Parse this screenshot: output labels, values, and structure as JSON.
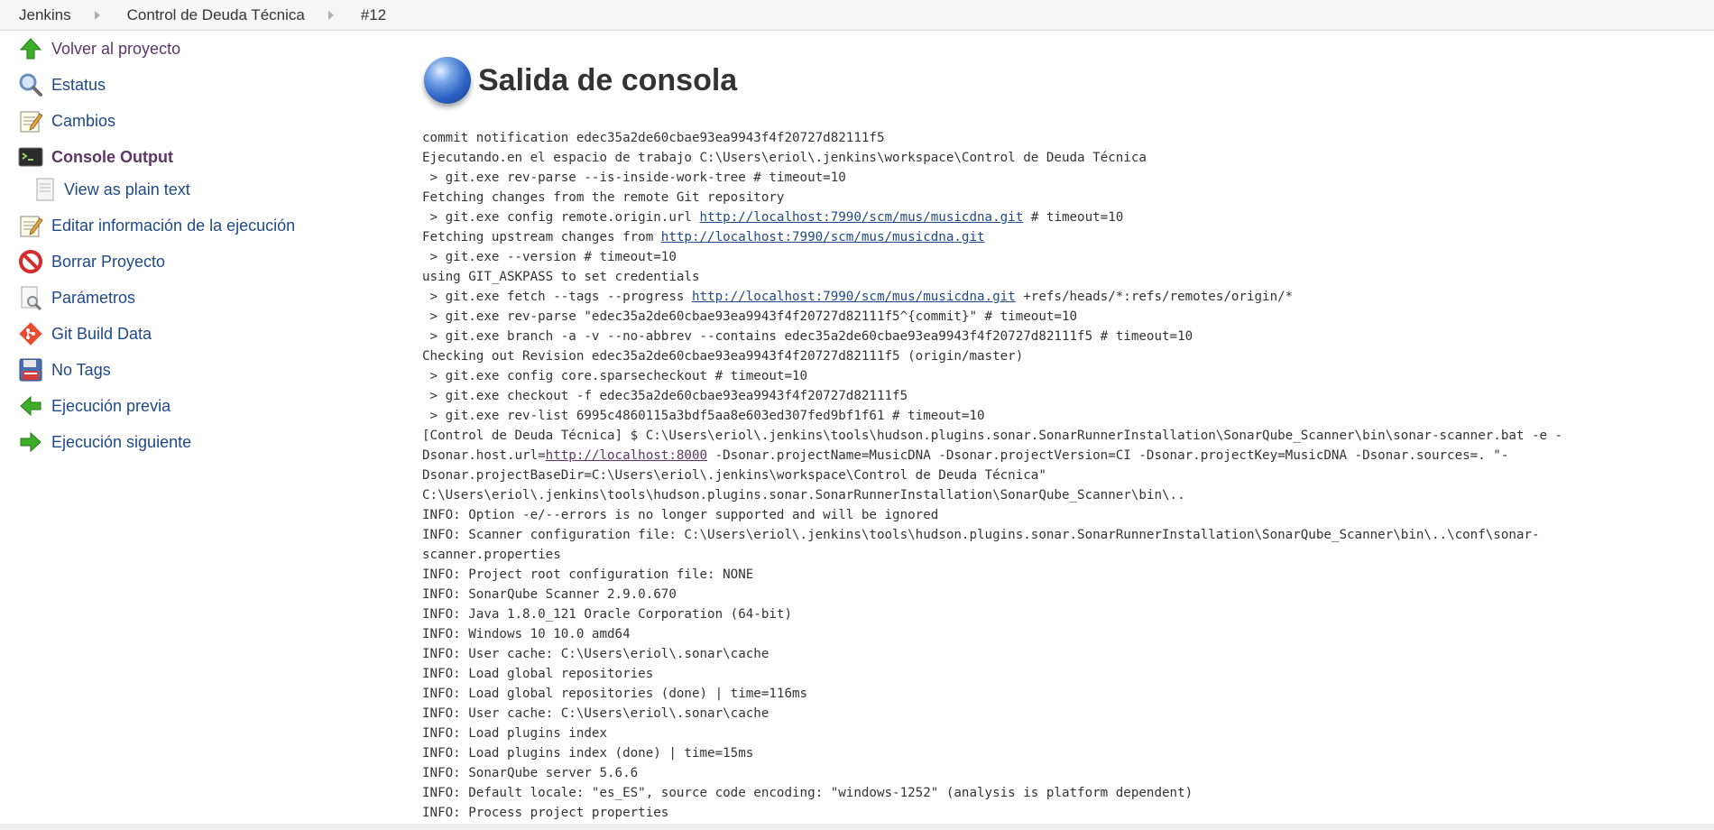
{
  "breadcrumb": [
    "Jenkins",
    "Control de Deuda Técnica",
    "#12"
  ],
  "sidebar": {
    "items": [
      {
        "label": "Volver al proyecto",
        "icon": "up-arrow-icon"
      },
      {
        "label": "Estatus",
        "icon": "magnifier-icon"
      },
      {
        "label": "Cambios",
        "icon": "notepad-icon"
      },
      {
        "label": "Console Output",
        "icon": "terminal-icon"
      },
      {
        "label": "View as plain text",
        "icon": "document-icon"
      },
      {
        "label": "Editar información de la ejecución",
        "icon": "notepad-icon"
      },
      {
        "label": "Borrar Proyecto",
        "icon": "no-entry-icon"
      },
      {
        "label": "Parámetros",
        "icon": "document-magnifier-icon"
      },
      {
        "label": "Git Build Data",
        "icon": "git-icon"
      },
      {
        "label": "No Tags",
        "icon": "save-icon"
      },
      {
        "label": "Ejecución previa",
        "icon": "left-arrow-icon"
      },
      {
        "label": "Ejecución siguiente",
        "icon": "right-arrow-icon"
      }
    ]
  },
  "main": {
    "title": "Salida de consola",
    "console": [
      {
        "t": "commit notification edec35a2de60cbae93ea9943f4f20727d82111f5"
      },
      {
        "t": "Ejecutando.en el espacio de trabajo C:\\Users\\eriol\\.jenkins\\workspace\\Control de Deuda Técnica"
      },
      {
        "t": " > git.exe rev-parse --is-inside-work-tree # timeout=10"
      },
      {
        "t": "Fetching changes from the remote Git repository"
      },
      {
        "t": " > git.exe config remote.origin.url ",
        "link": "http://localhost:7990/scm/mus/musicdna.git",
        "after": " # timeout=10"
      },
      {
        "t": "Fetching upstream changes from ",
        "link": "http://localhost:7990/scm/mus/musicdna.git",
        "after": ""
      },
      {
        "t": " > git.exe --version # timeout=10"
      },
      {
        "t": "using GIT_ASKPASS to set credentials"
      },
      {
        "t": " > git.exe fetch --tags --progress ",
        "link": "http://localhost:7990/scm/mus/musicdna.git",
        "after": " +refs/heads/*:refs/remotes/origin/*"
      },
      {
        "t": " > git.exe rev-parse \"edec35a2de60cbae93ea9943f4f20727d82111f5^{commit}\" # timeout=10"
      },
      {
        "t": " > git.exe branch -a -v --no-abbrev --contains edec35a2de60cbae93ea9943f4f20727d82111f5 # timeout=10"
      },
      {
        "t": "Checking out Revision edec35a2de60cbae93ea9943f4f20727d82111f5 (origin/master)"
      },
      {
        "t": " > git.exe config core.sparsecheckout # timeout=10"
      },
      {
        "t": " > git.exe checkout -f edec35a2de60cbae93ea9943f4f20727d82111f5"
      },
      {
        "t": " > git.exe rev-list 6995c4860115a3bdf5aa8e603ed307fed9bf1f61 # timeout=10"
      },
      {
        "t": "[Control de Deuda Técnica] $ C:\\Users\\eriol\\.jenkins\\tools\\hudson.plugins.sonar.SonarRunnerInstallation\\SonarQube_Scanner\\bin\\sonar-scanner.bat -e -"
      },
      {
        "t": "Dsonar.host.url=",
        "link": "http://localhost:8000",
        "after": " -Dsonar.projectName=MusicDNA -Dsonar.projectVersion=CI -Dsonar.projectKey=MusicDNA -Dsonar.sources=. \"-",
        "visited": true
      },
      {
        "t": "Dsonar.projectBaseDir=C:\\Users\\eriol\\.jenkins\\workspace\\Control de Deuda Técnica\""
      },
      {
        "t": "C:\\Users\\eriol\\.jenkins\\tools\\hudson.plugins.sonar.SonarRunnerInstallation\\SonarQube_Scanner\\bin\\.."
      },
      {
        "t": "INFO: Option -e/--errors is no longer supported and will be ignored"
      },
      {
        "t": "INFO: Scanner configuration file: C:\\Users\\eriol\\.jenkins\\tools\\hudson.plugins.sonar.SonarRunnerInstallation\\SonarQube_Scanner\\bin\\..\\conf\\sonar-"
      },
      {
        "t": "scanner.properties"
      },
      {
        "t": "INFO: Project root configuration file: NONE"
      },
      {
        "t": "INFO: SonarQube Scanner 2.9.0.670"
      },
      {
        "t": "INFO: Java 1.8.0_121 Oracle Corporation (64-bit)"
      },
      {
        "t": "INFO: Windows 10 10.0 amd64"
      },
      {
        "t": "INFO: User cache: C:\\Users\\eriol\\.sonar\\cache"
      },
      {
        "t": "INFO: Load global repositories"
      },
      {
        "t": "INFO: Load global repositories (done) | time=116ms"
      },
      {
        "t": "INFO: User cache: C:\\Users\\eriol\\.sonar\\cache"
      },
      {
        "t": "INFO: Load plugins index"
      },
      {
        "t": "INFO: Load plugins index (done) | time=15ms"
      },
      {
        "t": "INFO: SonarQube server 5.6.6"
      },
      {
        "t": "INFO: Default locale: \"es_ES\", source code encoding: \"windows-1252\" (analysis is platform dependent)"
      },
      {
        "t": "INFO: Process project properties"
      }
    ]
  },
  "colors": {
    "link": "#204A87",
    "visited": "#5c3566",
    "breadcrumb_bg": "#f6f6f6"
  }
}
